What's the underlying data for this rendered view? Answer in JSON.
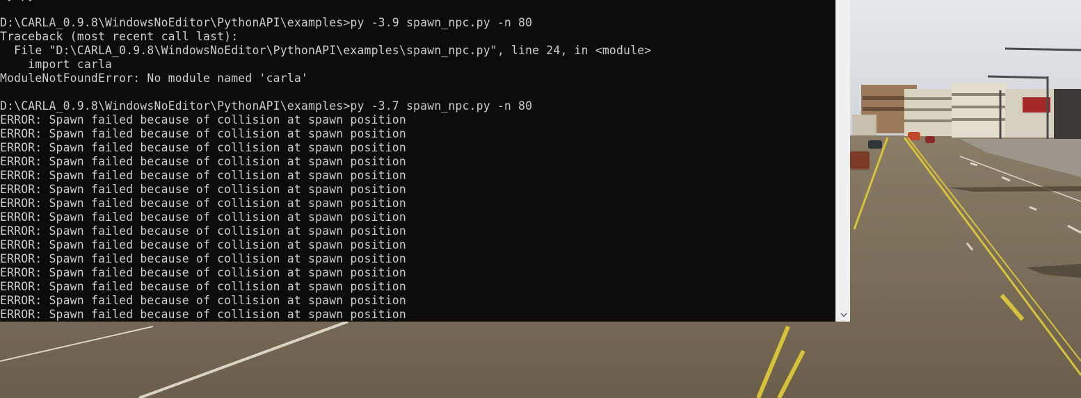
{
  "console": {
    "lines": [
      "ty.py",
      "",
      "D:\\CARLA_0.9.8\\WindowsNoEditor\\PythonAPI\\examples>py -3.9 spawn_npc.py -n 80",
      "Traceback (most recent call last):",
      "  File \"D:\\CARLA_0.9.8\\WindowsNoEditor\\PythonAPI\\examples\\spawn_npc.py\", line 24, in <module>",
      "    import carla",
      "ModuleNotFoundError: No module named 'carla'",
      "",
      "D:\\CARLA_0.9.8\\WindowsNoEditor\\PythonAPI\\examples>py -3.7 spawn_npc.py -n 80",
      "ERROR: Spawn failed because of collision at spawn position",
      "ERROR: Spawn failed because of collision at spawn position",
      "ERROR: Spawn failed because of collision at spawn position",
      "ERROR: Spawn failed because of collision at spawn position",
      "ERROR: Spawn failed because of collision at spawn position",
      "ERROR: Spawn failed because of collision at spawn position",
      "ERROR: Spawn failed because of collision at spawn position",
      "ERROR: Spawn failed because of collision at spawn position",
      "ERROR: Spawn failed because of collision at spawn position",
      "ERROR: Spawn failed because of collision at spawn position",
      "ERROR: Spawn failed because of collision at spawn position",
      "ERROR: Spawn failed because of collision at spawn position",
      "ERROR: Spawn failed because of collision at spawn position",
      "ERROR: Spawn failed because of collision at spawn position",
      "ERROR: Spawn failed because of collision at spawn position"
    ],
    "background": "#0c0c0c",
    "text_color": "#cccccc"
  },
  "scrollbar": {
    "down_icon": "chevron-down-icon"
  },
  "scene": {
    "road_color": "#6e6350",
    "sky_color": "#d9dde1",
    "lane_line_color": "#d8c23a"
  }
}
